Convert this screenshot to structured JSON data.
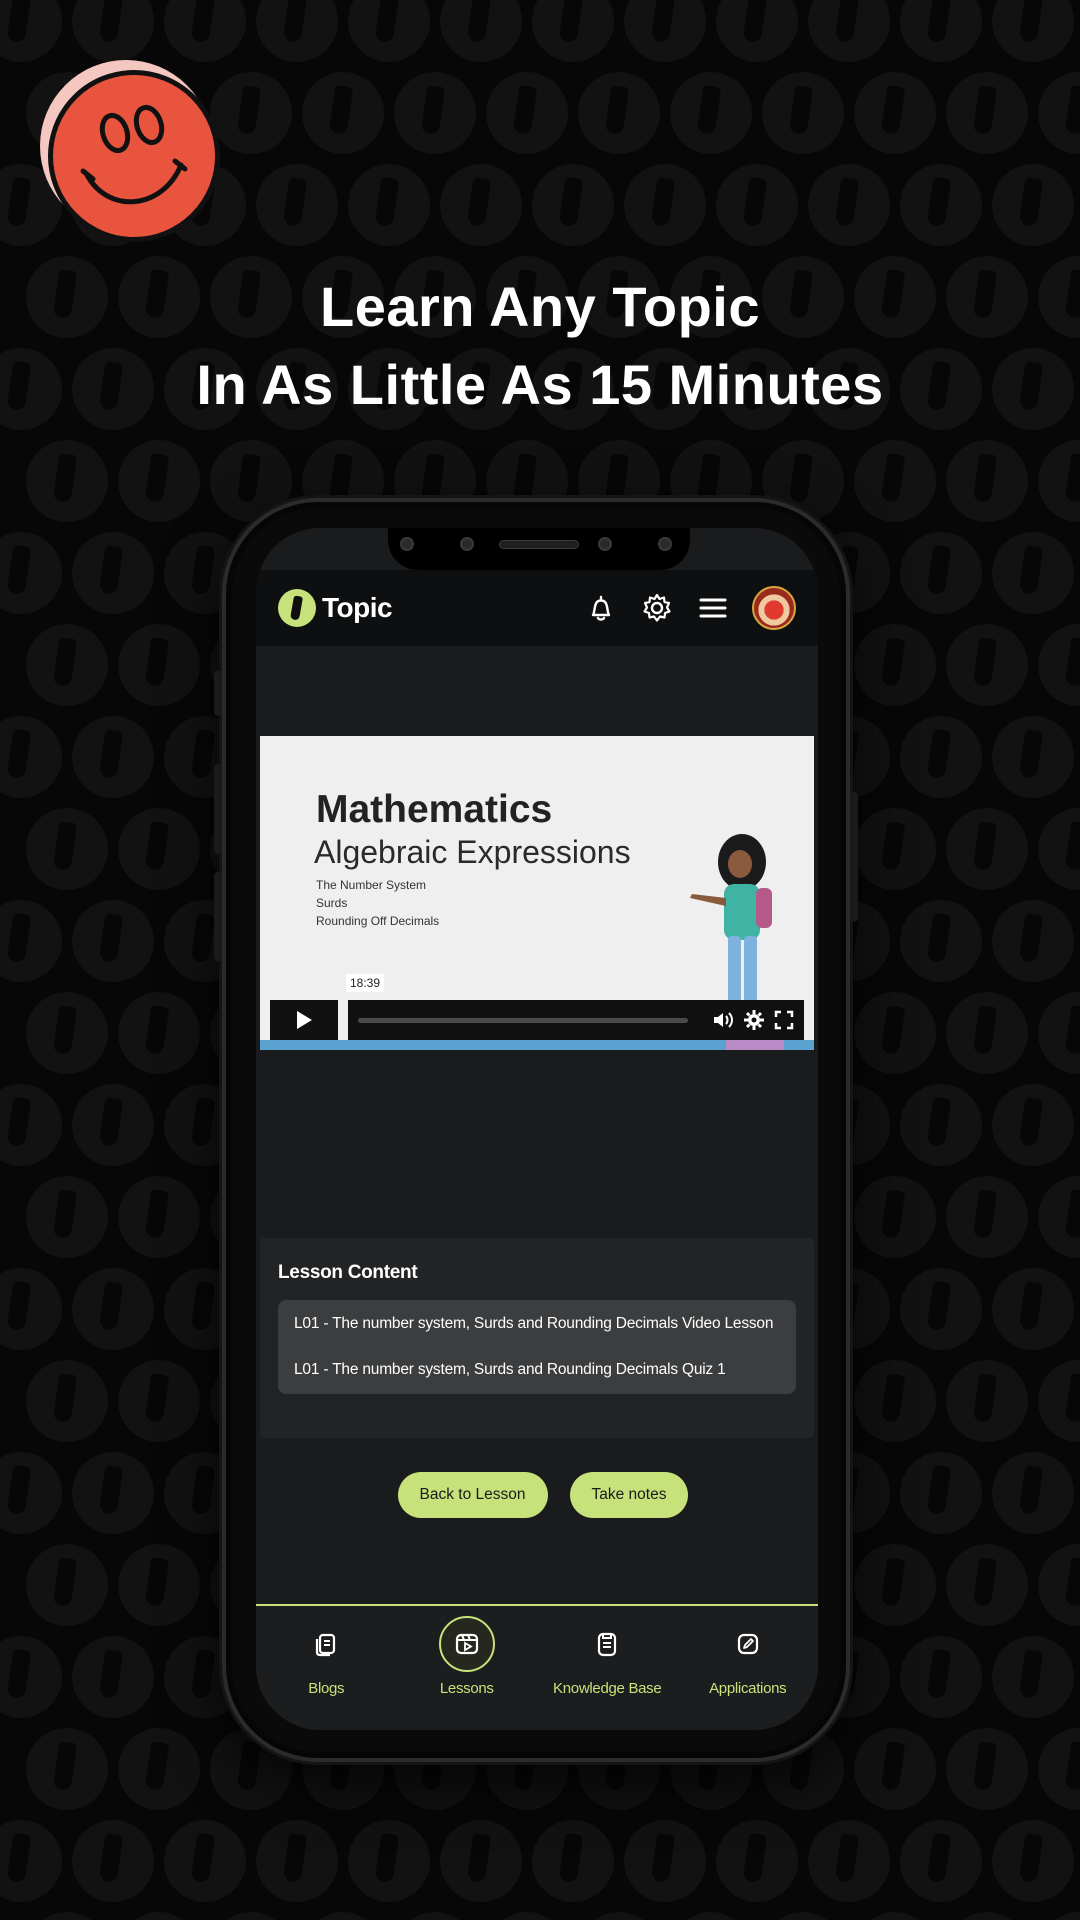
{
  "headline": {
    "line1": "Learn Any Topic",
    "line2": "In As Little As 15 Minutes"
  },
  "app": {
    "brand_name": "Topic",
    "header_icons": [
      "bell-icon",
      "gear-icon",
      "menu-icon",
      "avatar"
    ]
  },
  "video": {
    "title": "Mathematics",
    "subtitle": "Algebraic Expressions",
    "topics": [
      "The Number System",
      "Surds",
      "Rounding Off Decimals"
    ],
    "time": "18:39"
  },
  "lesson": {
    "heading": "Lesson Content",
    "items": [
      "L01 - The number system, Surds and Rounding Decimals Video Lesson",
      "L01 - The number system, Surds and Rounding Decimals Quiz 1"
    ]
  },
  "actions": {
    "back_label": "Back to Lesson",
    "notes_label": "Take notes"
  },
  "nav": {
    "items": [
      {
        "label": "Blogs",
        "icon": "blog-icon",
        "active": false
      },
      {
        "label": "Lessons",
        "icon": "lessons-icon",
        "active": true
      },
      {
        "label": "Knowledge Base",
        "icon": "knowledge-base-icon",
        "active": false
      },
      {
        "label": "Applications",
        "icon": "applications-icon",
        "active": false
      }
    ]
  },
  "colors": {
    "accent": "#c7e27a",
    "smiley": "#e8543e",
    "background": "#070707"
  }
}
